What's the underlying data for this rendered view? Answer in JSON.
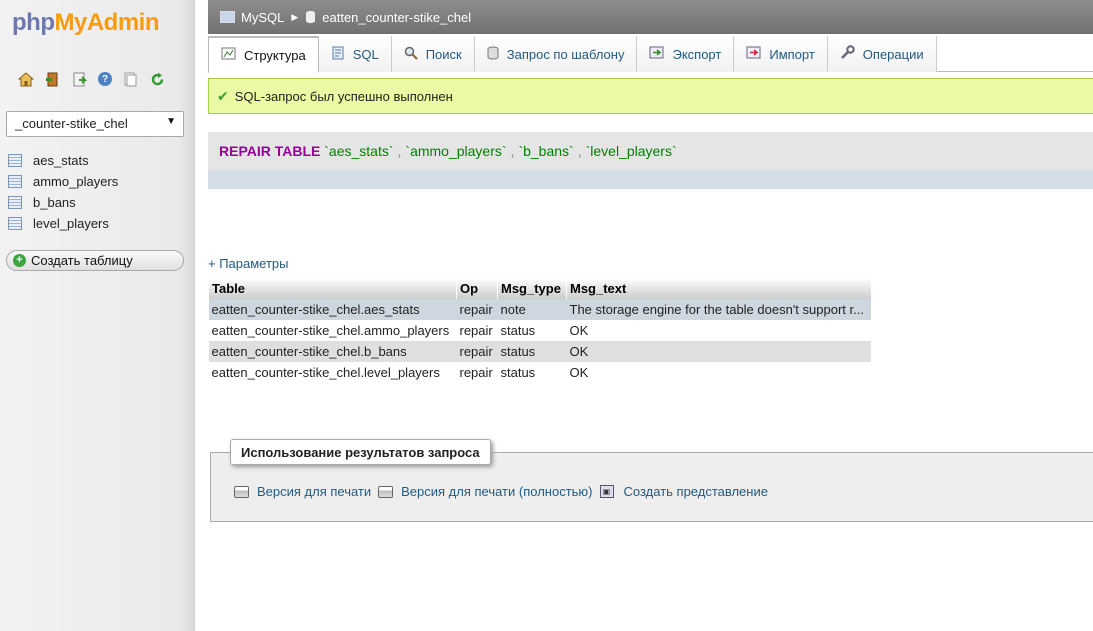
{
  "logo": {
    "php": "php",
    "my": "MyAdmin"
  },
  "nav_icons": [
    "home-icon",
    "logout-icon",
    "sql-query-icon",
    "help-icon",
    "docs-icon",
    "reload-icon"
  ],
  "db_selector": {
    "value": "_counter-stike_chel"
  },
  "sidebar": {
    "tables": [
      {
        "label": "aes_stats"
      },
      {
        "label": "ammo_players"
      },
      {
        "label": "b_bans"
      },
      {
        "label": "level_players"
      }
    ],
    "create_table": "Создать таблицу"
  },
  "breadcrumb": {
    "server": "MySQL",
    "database": "eatten_counter-stike_chel"
  },
  "tabs": [
    {
      "label": "Структура",
      "icon": "structure-icon",
      "active": true
    },
    {
      "label": "SQL",
      "icon": "sql-icon"
    },
    {
      "label": "Поиск",
      "icon": "search-icon"
    },
    {
      "label": "Запрос по шаблону",
      "icon": "query-icon"
    },
    {
      "label": "Экспорт",
      "icon": "export-icon"
    },
    {
      "label": "Импорт",
      "icon": "import-icon"
    },
    {
      "label": "Операции",
      "icon": "wrench-icon"
    }
  ],
  "success_message": "SQL-запрос был успешно выполнен",
  "sql": {
    "keyword": "REPAIR TABLE",
    "tables": [
      "`aes_stats`",
      "`ammo_players`",
      "`b_bans`",
      "`level_players`"
    ],
    "separator": ","
  },
  "params_link": "+ Параметры",
  "result": {
    "headers": [
      "Table",
      "Op",
      "Msg_type",
      "Msg_text"
    ],
    "rows": [
      [
        "eatten_counter-stike_chel.aes_stats",
        "repair",
        "note",
        "The storage engine for the table doesn't support r..."
      ],
      [
        "eatten_counter-stike_chel.ammo_players",
        "repair",
        "status",
        "OK"
      ],
      [
        "eatten_counter-stike_chel.b_bans",
        "repair",
        "status",
        "OK"
      ],
      [
        "eatten_counter-stike_chel.level_players",
        "repair",
        "status",
        "OK"
      ]
    ]
  },
  "query_ops": {
    "legend": "Использование результатов запроса",
    "print": "Версия для печати",
    "print_full": "Версия для печати (полностью)",
    "create_view": "Создать представление"
  },
  "colors": {
    "success_bg": "#ebf8a4",
    "link": "#235a81",
    "keyword": "#990099",
    "identifier": "#008000"
  }
}
